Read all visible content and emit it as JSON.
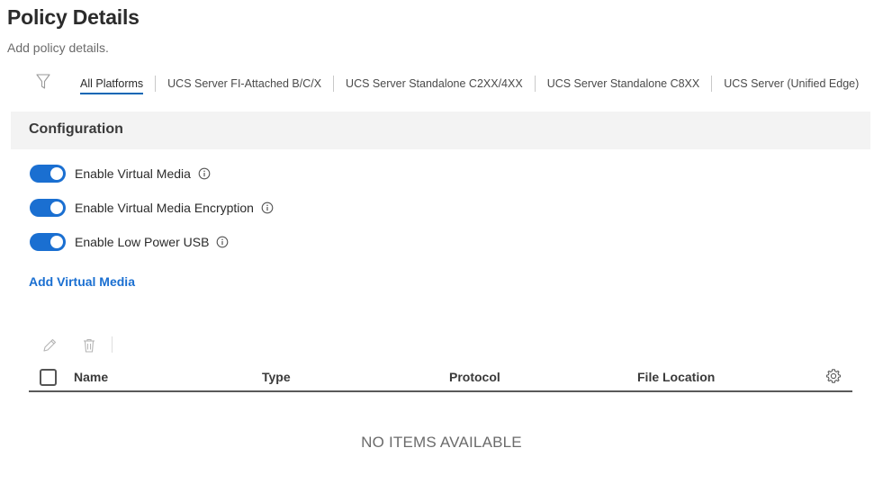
{
  "page": {
    "title": "Policy Details",
    "subtitle": "Add policy details."
  },
  "platform_tabs": {
    "filter_icon": "filter-icon",
    "items": [
      {
        "label": "All Platforms",
        "active": true
      },
      {
        "label": "UCS Server FI-Attached B/C/X",
        "active": false
      },
      {
        "label": "UCS Server Standalone C2XX/4XX",
        "active": false
      },
      {
        "label": "UCS Server Standalone C8XX",
        "active": false
      },
      {
        "label": "UCS Server (Unified Edge)",
        "active": false
      }
    ]
  },
  "configuration": {
    "title": "Configuration",
    "toggles": [
      {
        "label": "Enable Virtual Media",
        "enabled": true
      },
      {
        "label": "Enable Virtual Media Encryption",
        "enabled": true
      },
      {
        "label": "Enable Low Power USB",
        "enabled": true
      }
    ],
    "add_link": "Add Virtual Media"
  },
  "table": {
    "toolbar": [
      "edit-icon",
      "trash-icon"
    ],
    "columns": [
      "Name",
      "Type",
      "Protocol",
      "File Location"
    ],
    "settings_icon": "gear-icon",
    "empty_message": "NO ITEMS AVAILABLE",
    "rows": []
  },
  "colors": {
    "accent": "#1a6fd1",
    "tab_underline": "#0b67b5",
    "config_bar": "#f3f3f3"
  }
}
